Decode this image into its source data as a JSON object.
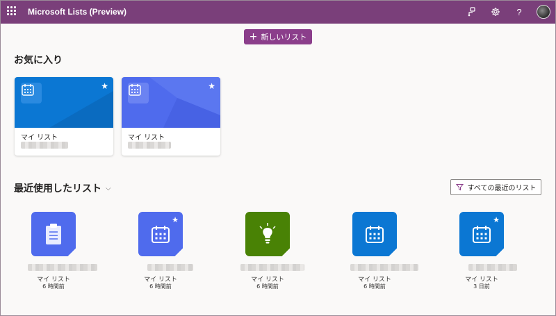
{
  "app": {
    "title": "Microsoft Lists (Preview)"
  },
  "toolbar": {
    "new_list_label": "新しいリスト"
  },
  "favorites": {
    "heading": "お気に入り",
    "cards": [
      {
        "name": "マイ リスト",
        "color": "#0b77d3",
        "icon": "calendar-icon",
        "starred": true
      },
      {
        "name": "マイ リスト",
        "color": "#4f6bed",
        "icon": "calendar-icon",
        "starred": true
      }
    ]
  },
  "recent": {
    "heading": "最近使用したリスト",
    "filter_label": "すべての最近のリスト",
    "items": [
      {
        "name": "マイ リスト",
        "time": "6 時間前",
        "color": "#4f6bed",
        "icon": "clipboard-icon",
        "starred": false
      },
      {
        "name": "マイ リスト",
        "time": "6 時間前",
        "color": "#4f6bed",
        "icon": "calendar-icon",
        "starred": true
      },
      {
        "name": "マイ リスト",
        "time": "6 時間前",
        "color": "#498205",
        "icon": "lightbulb-icon",
        "starred": false
      },
      {
        "name": "マイ リスト",
        "time": "6 時間前",
        "color": "#0b77d3",
        "icon": "calendar-icon",
        "starred": false
      },
      {
        "name": "マイ リスト",
        "time": "3 日前",
        "color": "#0b77d3",
        "icon": "calendar-icon",
        "starred": true
      }
    ]
  },
  "colors": {
    "header": "#7a3f7a",
    "accent_button": "#8b3e8b"
  }
}
